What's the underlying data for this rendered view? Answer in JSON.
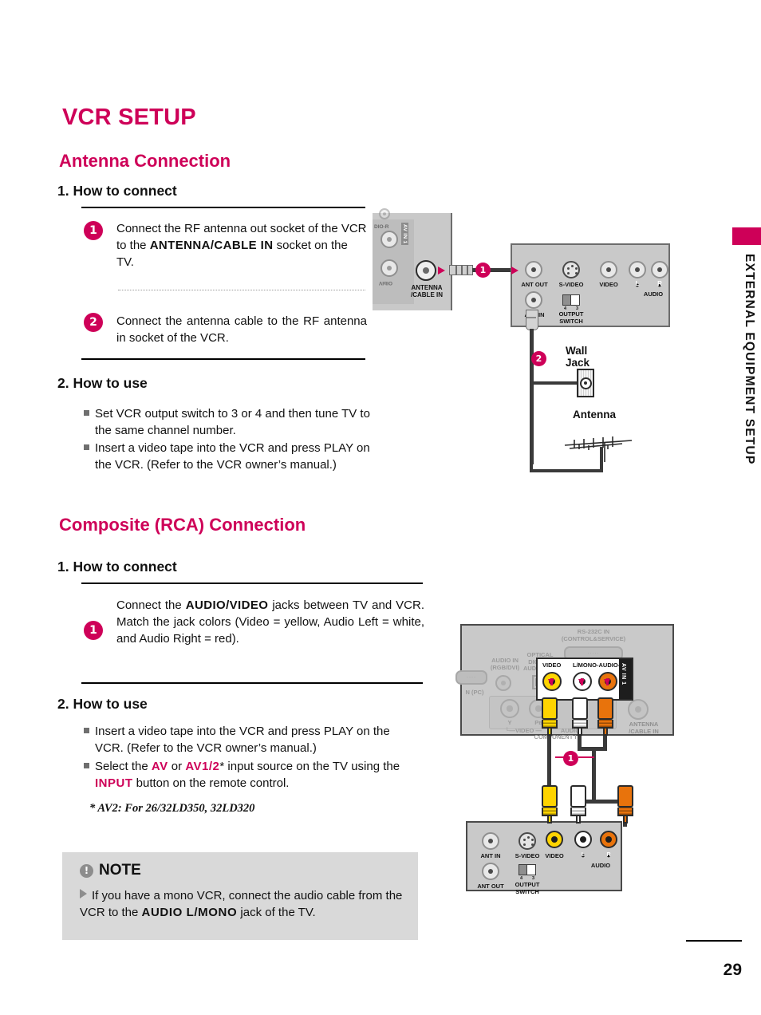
{
  "page": {
    "title": "VCR SETUP",
    "number": "29",
    "side_tab": "EXTERNAL EQUIPMENT SETUP",
    "accent_color": "#CE0058"
  },
  "sections": [
    {
      "heading": "Antenna Connection",
      "connect_heading": "1. How to connect",
      "steps": [
        {
          "num": "1",
          "pre": "Connect the RF antenna out socket of the VCR to the ",
          "bold": "ANTENNA/CABLE IN",
          "post": " socket on the TV."
        },
        {
          "num": "2",
          "pre": "Connect the antenna cable to the RF antenna in socket of the VCR.",
          "bold": "",
          "post": ""
        }
      ],
      "use_heading": "2. How to use",
      "bullets": [
        "Set VCR output switch to 3 or 4 and then tune TV to the same channel number.",
        "Insert a video tape into the VCR and press PLAY on the VCR. (Refer to the VCR owner’s manual.)"
      ]
    },
    {
      "heading": "Composite (RCA) Connection",
      "connect_heading": "1. How to connect",
      "step1_pre": "Connect the ",
      "step1_bold": "AUDIO/VIDEO",
      "step1_post": " jacks between TV and VCR. Match the jack colors (Video = yellow, Audio Left = white, and Audio Right = red).",
      "use_heading": "2. How to use",
      "bullet1": "Insert a video tape into the VCR and press PLAY on the VCR. (Refer to the VCR owner’s manual.)",
      "bullet2_a": "Select the ",
      "bullet2_kw1": "AV",
      "bullet2_b": " or ",
      "bullet2_kw2": "AV1/2",
      "bullet2_c": "* input source on the TV using the ",
      "bullet2_kw3": "INPUT",
      "bullet2_d": " button on the remote control.",
      "footnote": "* AV2: For 26/32LD350, 32LD320"
    }
  ],
  "note": {
    "title": "NOTE",
    "pre": "If you have a mono VCR, connect the audio cable from the VCR to the ",
    "bold": "AUDIO L/MONO",
    "post": " jack of the TV."
  },
  "diagram_top": {
    "tv_panel": {
      "audio_r": "DIO-R",
      "av_in": "AV IN 1",
      "antenna": "ANTENNA\n/CABLE IN"
    },
    "badge1": "1",
    "badge2": "2",
    "vcr_panel": {
      "ant_out": "ANT OUT",
      "s_video": "S-VIDEO",
      "video": "VIDEO",
      "audio_l": "L",
      "audio_r": "R",
      "audio": "AUDIO",
      "ant_in": "ANT IN",
      "output_switch": "OUTPUT\nSWITCH",
      "sw_left": "4",
      "sw_right": "3"
    },
    "wall_jack": "Wall Jack",
    "antenna": "Antenna"
  },
  "diagram_bottom": {
    "tv_back": {
      "rs232": "RS-232C IN\n(CONTROL&SERVICE)",
      "audio_in": "AUDIO IN\n(RGB/DVI)",
      "optical": "OPTICAL\nDIGITAL\nAUDIO OUT",
      "rgb_pc": "N (PC)",
      "comp_y": "Y",
      "comp_pb": "Pв",
      "comp_video": "VIDEO",
      "component_in": "COMPONENT I",
      "audio_lbl": "AUDIO",
      "antenna": "ANTENNA\n/CABLE IN",
      "av_video": "VIDEO",
      "av_audio": "L/MONO-AUDIO-R",
      "av_in1": "AV IN 1"
    },
    "badge1": "1",
    "vcr_panel": {
      "ant_in": "ANT IN",
      "s_video": "S-VIDEO",
      "video": "VIDEO",
      "audio_l": "L",
      "audio_r": "R",
      "audio": "AUDIO",
      "ant_out": "ANT OUT",
      "output_switch": "OUTPUT\nSWITCH",
      "sw_left": "4",
      "sw_right": "3"
    }
  }
}
